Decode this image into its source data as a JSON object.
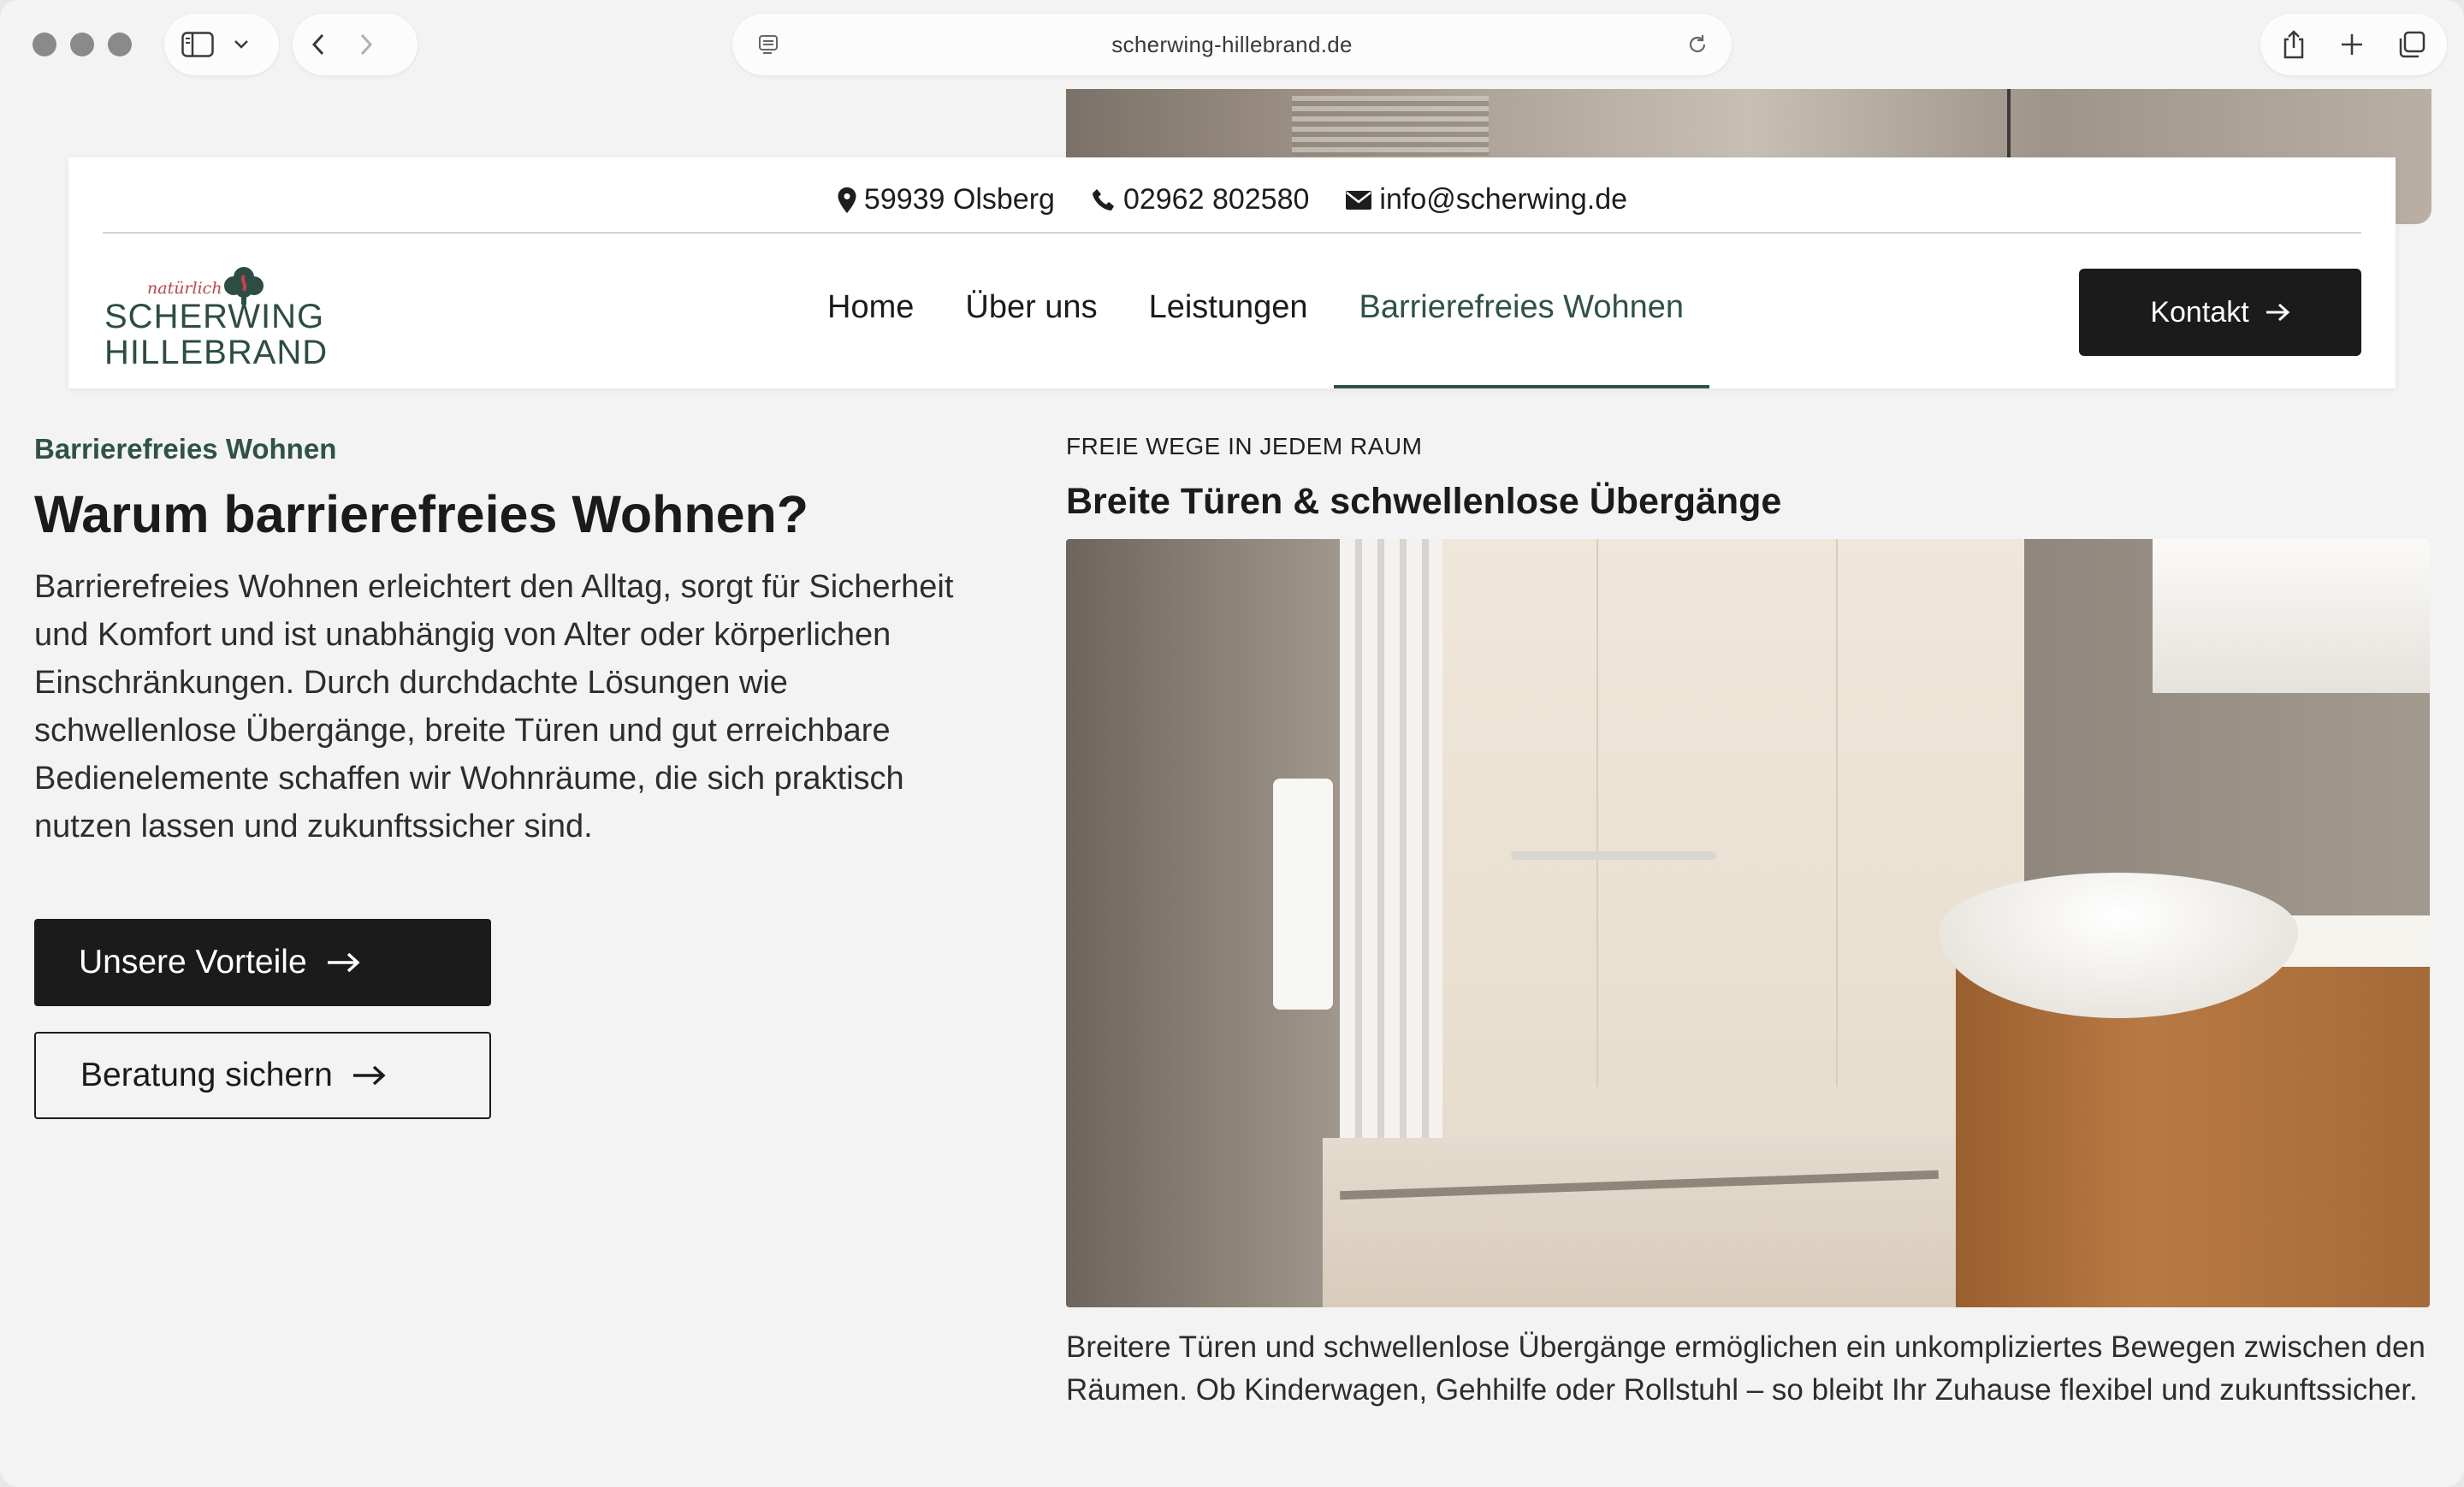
{
  "browser": {
    "url": "scherwing-hillebrand.de"
  },
  "topbar": {
    "address": "59939 Olsberg",
    "phone": "02962 802580",
    "email": "info@scherwing.de"
  },
  "logo": {
    "script": "natürlich",
    "line1": "SCHERWING",
    "line2": "HILLEBRAND"
  },
  "nav": {
    "items": [
      {
        "label": "Home"
      },
      {
        "label": "Über uns"
      },
      {
        "label": "Leistungen"
      },
      {
        "label": "Barrierefreies Wohnen",
        "active": true
      }
    ],
    "cta": "Kontakt"
  },
  "left": {
    "eyebrow": "Barrierefreies Wohnen",
    "heading": "Warum barrierefreies Wohnen?",
    "body": "Barrierefreies Wohnen erleichtert den Alltag, sorgt für Sicherheit und Komfort und ist unabhängig von Alter oder körperlichen Einschränkungen. Durch durchdachte Lösungen wie schwellenlose Übergänge, breite Türen und gut erreichbare Bedienelemente schaffen wir Wohnräume, die sich praktisch nutzen lassen und zukunftssicher sind.",
    "primary_button": "Unsere Vorteile",
    "secondary_button": "Beratung sichern"
  },
  "right": {
    "eyebrow": "FREIE WEGE IN JEDEM RAUM",
    "heading": "Breite Türen & schwellenlose Übergänge",
    "caption": "Breitere Türen und schwellenlose Übergänge ermöglichen ein unkompliziertes Bewegen zwischen den Räumen. Ob Kinderwagen, Gehhilfe oder Rollstuhl – so bleibt Ihr Zuhause flexibel und zukunftssicher."
  },
  "colors": {
    "brand_green": "#2f5247",
    "brand_red": "#c8414b",
    "dark": "#1b1b1b",
    "page_bg": "#f3f3f3"
  }
}
